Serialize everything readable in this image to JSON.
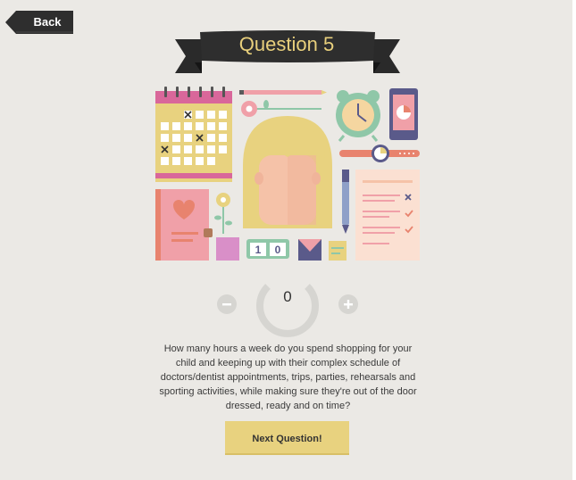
{
  "nav": {
    "back_label": "Back"
  },
  "banner": {
    "title": "Question 5"
  },
  "illustration": {
    "icons": [
      "calendar-icon",
      "pencil-icon",
      "flower-icon",
      "alarm-clock-icon",
      "smartphone-icon",
      "watch-icon",
      "girl-face-icon",
      "notebook-icon",
      "pen-icon",
      "checklist-icon",
      "counter-icon",
      "envelope-icon",
      "sticky-note-icon"
    ],
    "counter_digits": [
      "1",
      "0"
    ]
  },
  "stepper": {
    "value": "0",
    "minus_icon": "minus-icon",
    "plus_icon": "plus-icon"
  },
  "question": {
    "lines": [
      "How many hours a week do you spend shopping for your",
      "child and keeping up with their complex schedule of",
      "doctors/dentist appointments, trips, parties, rehearsals and",
      "sporting activities, while making sure they're out of the door",
      "dressed, ready and on time?"
    ]
  },
  "actions": {
    "next_label": "Next Question!"
  },
  "colors": {
    "background": "#ebe9e5",
    "banner": "#2e2e2e",
    "banner_text": "#e8cf7c",
    "button": "#e8d27f"
  }
}
